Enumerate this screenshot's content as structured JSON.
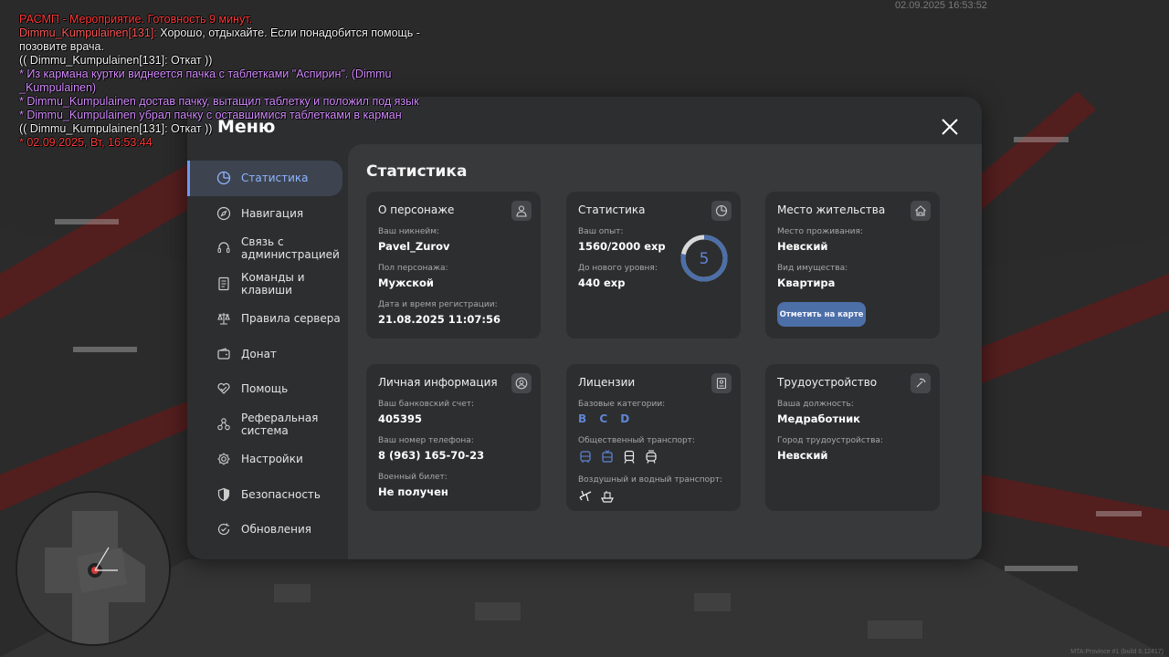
{
  "timestamp": "02.09.2025 16:53:52",
  "build_tag": "MTA:Province #1 (build 6.12417)",
  "chat": [
    {
      "text": "РАСМП - Мероприятие. Готовность 9 минут.",
      "color": "red"
    },
    {
      "name": "Dimmu_Kumpulainen[131]:",
      "text": " Хорошо, отдыхайте. Если понадобится помощь - позовите врача.",
      "color": "white"
    },
    {
      "text": "(( Dimmu_Kumpulainen[131]: Откат ))",
      "color": "white"
    },
    {
      "text": "* Из кармана куртки виднеется пачка с таблетками \"Аспирин\". (Dimmu _Kumpulainen)",
      "color": "purple"
    },
    {
      "text": "* Dimmu_Kumpulainen достав пачку, вытащил таблетку и положил под язык",
      "color": "purple"
    },
    {
      "text": "* Dimmu_Kumpulainen убрал пачку с оставшимися таблетками в карман",
      "color": "purple"
    },
    {
      "text": "(( Dimmu_Kumpulainen[131]: Откат ))",
      "color": "white"
    },
    {
      "text": "* 02.09.2025, Вт, 16:53:44",
      "color": "red"
    }
  ],
  "menu": {
    "title": "Меню",
    "close_icon": "close-icon",
    "sidebar": [
      {
        "label": "Статистика",
        "icon": "pie-chart-icon",
        "active": true
      },
      {
        "label": "Навигация",
        "icon": "compass-icon"
      },
      {
        "label": "Связь с\nадминистрацией",
        "icon": "headset-icon"
      },
      {
        "label": "Команды и\nклавиши",
        "icon": "document-icon"
      },
      {
        "label": "Правила сервера",
        "icon": "scales-icon"
      },
      {
        "label": "Донат",
        "icon": "wallet-icon"
      },
      {
        "label": "Помощь",
        "icon": "heart-hands-icon"
      },
      {
        "label": "Реферальная\nсистема",
        "icon": "network-icon"
      },
      {
        "label": "Настройки",
        "icon": "gear-icon"
      },
      {
        "label": "Безопасность",
        "icon": "shield-icon"
      },
      {
        "label": "Обновления",
        "icon": "refresh-check-icon"
      }
    ],
    "content_title": "Статистика",
    "cards": {
      "character": {
        "title": "О персонаже",
        "nickname_label": "Ваш никнейм:",
        "nickname": "Pavel_Zurov",
        "gender_label": "Пол персонажа:",
        "gender": "Мужской",
        "reg_label": "Дата и время регистрации:",
        "reg": "21.08.2025 11:07:56"
      },
      "stats": {
        "title": "Статистика",
        "exp_label": "Ваш опыт:",
        "exp": "1560/2000 exp",
        "next_label": "До нового уровня:",
        "next": "440 exp",
        "level": "5",
        "level_progress": 0.78
      },
      "residence": {
        "title": "Место жительства",
        "place_label": "Место проживания:",
        "place": "Невский",
        "property_label": "Вид имущества:",
        "property": "Квартира",
        "map_button": "Отметить на карте"
      },
      "personal": {
        "title": "Личная информация",
        "bank_label": "Ваш банковский счет:",
        "bank": "405395",
        "phone_label": "Ваш номер телефона:",
        "phone": "8 (963) 165-70-23",
        "military_label": "Военный билет:",
        "military": "Не получен"
      },
      "licenses": {
        "title": "Лицензии",
        "basic_label": "Базовые категории:",
        "basic": "B C D",
        "public_label": "Общественный транспорт:",
        "public_icons": [
          "bus-icon",
          "trolleybus-icon",
          "train-icon",
          "tram-icon"
        ],
        "air_label": "Воздушный и водный транспорт:",
        "air_icons": [
          "plane-icon",
          "ship-icon"
        ]
      },
      "job": {
        "title": "Трудоустройство",
        "position_label": "Ваша должность:",
        "position": "Медработник",
        "city_label": "Город трудоустройства:",
        "city": "Невский"
      }
    }
  },
  "colors": {
    "accent": "#6f98ef",
    "button": "#4d6fa8",
    "chat_red": "#ff3b3b",
    "chat_purple": "#d48cff"
  }
}
